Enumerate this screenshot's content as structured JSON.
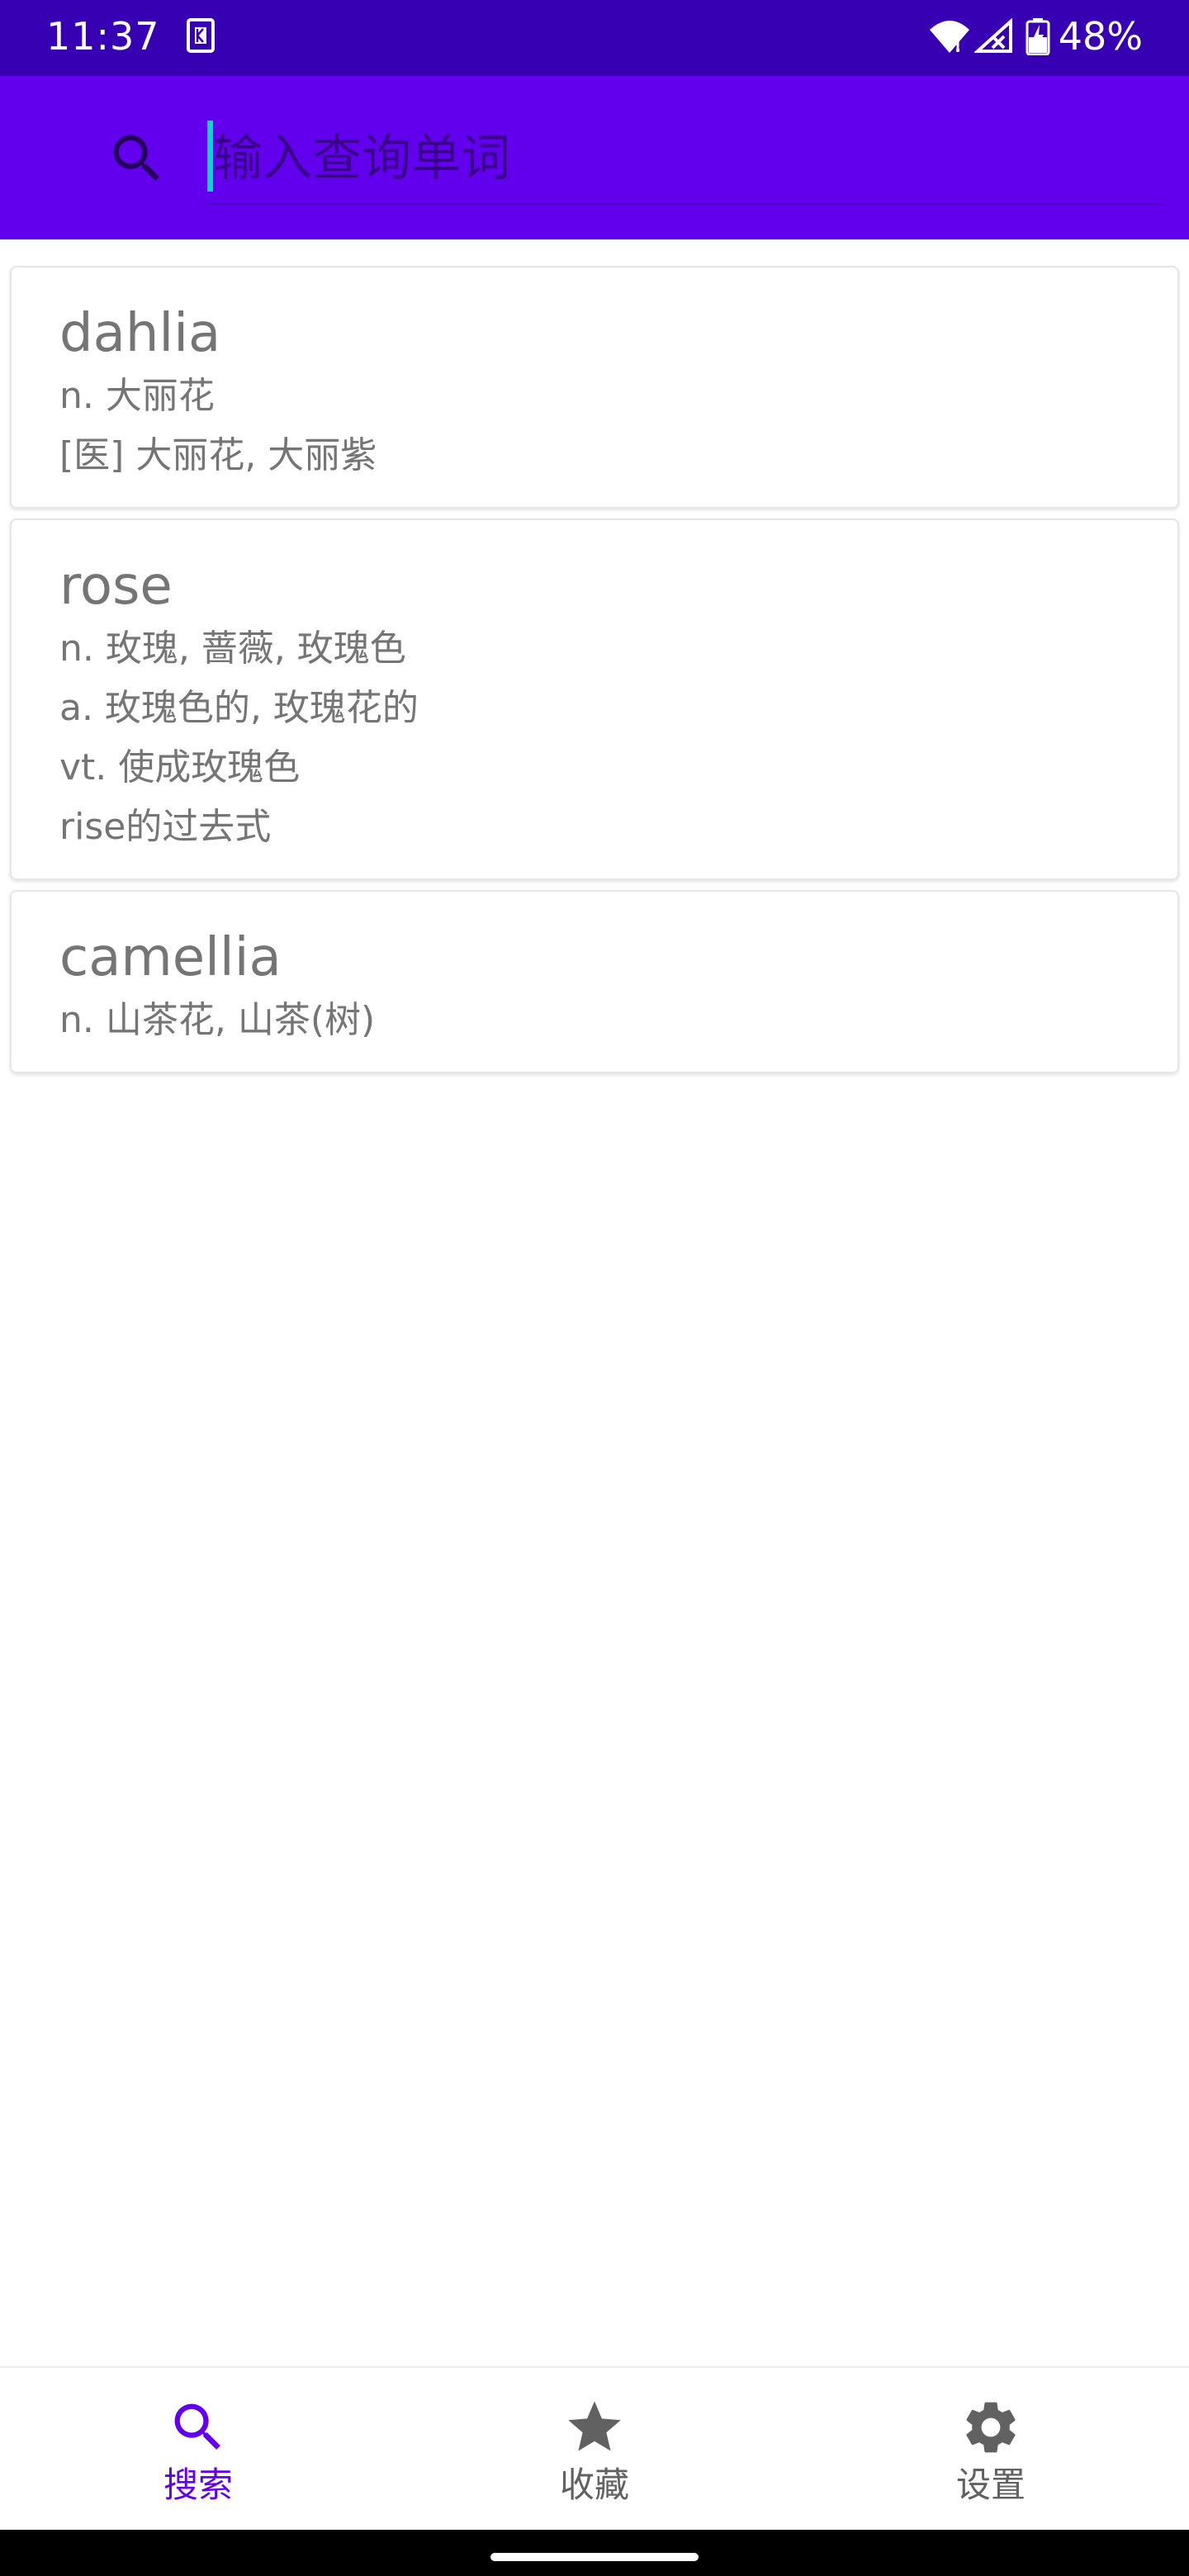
{
  "status_bar": {
    "time": "11:37",
    "app_icon": "k-app-icon",
    "battery": "48%",
    "icons": [
      "wifi-icon",
      "signal-icon",
      "battery-charging-icon"
    ],
    "background": "#3700b3"
  },
  "search": {
    "placeholder": "输入查询单词",
    "value": "",
    "icon": "search-icon",
    "background": "#6200ee",
    "caret_color": "#03dac5"
  },
  "words": [
    {
      "word": "dahlia",
      "definitions": [
        "n. 大丽花",
        "[医] 大丽花, 大丽紫"
      ]
    },
    {
      "word": "rose",
      "definitions": [
        "n. 玫瑰, 蔷薇, 玫瑰色",
        "a. 玫瑰色的, 玫瑰花的",
        "vt. 使成玫瑰色",
        "rise的过去式"
      ]
    },
    {
      "word": "camellia",
      "definitions": [
        "n. 山茶花, 山茶(树)"
      ]
    }
  ],
  "bottom_nav": {
    "items": [
      {
        "label": "搜索",
        "icon": "search-icon",
        "active": true
      },
      {
        "label": "收藏",
        "icon": "star-icon",
        "active": false
      },
      {
        "label": "设置",
        "icon": "gear-icon",
        "active": false
      }
    ],
    "active_color": "#6200ee",
    "inactive_color": "#616161"
  }
}
